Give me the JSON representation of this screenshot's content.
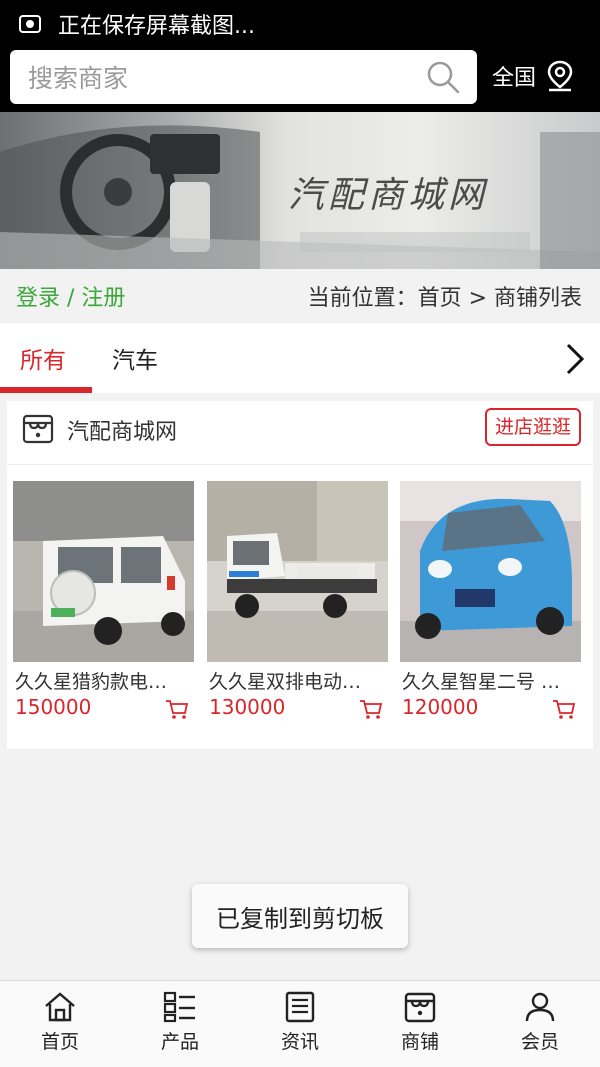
{
  "statusbar": {
    "text": "正在保存屏幕截图..."
  },
  "search": {
    "placeholder": "搜索商家",
    "region": "全国"
  },
  "banner": {
    "title": "汽配商城网"
  },
  "crumb": {
    "login": "登录 / 注册",
    "position": "当前位置：首页 > 商铺列表"
  },
  "tabs": [
    {
      "label": "所有",
      "active": true
    },
    {
      "label": "汽车",
      "active": false
    }
  ],
  "shop": {
    "name": "汽配商城网",
    "enter_label": "进店逛逛",
    "products": [
      {
        "name": "久久星猎豹款电…",
        "price": "150000"
      },
      {
        "name": "久久星双排电动…",
        "price": "130000"
      },
      {
        "name": "久久星智星二号 …",
        "price": "120000"
      }
    ]
  },
  "toast": {
    "text": "已复制到剪切板"
  },
  "bottomnav": [
    {
      "label": "首页",
      "icon": "home-icon"
    },
    {
      "label": "产品",
      "icon": "list-icon"
    },
    {
      "label": "资讯",
      "icon": "news-icon"
    },
    {
      "label": "商铺",
      "icon": "shop-icon"
    },
    {
      "label": "会员",
      "icon": "user-icon"
    }
  ],
  "colors": {
    "accent": "#d9262a",
    "login": "#3aa83a"
  }
}
